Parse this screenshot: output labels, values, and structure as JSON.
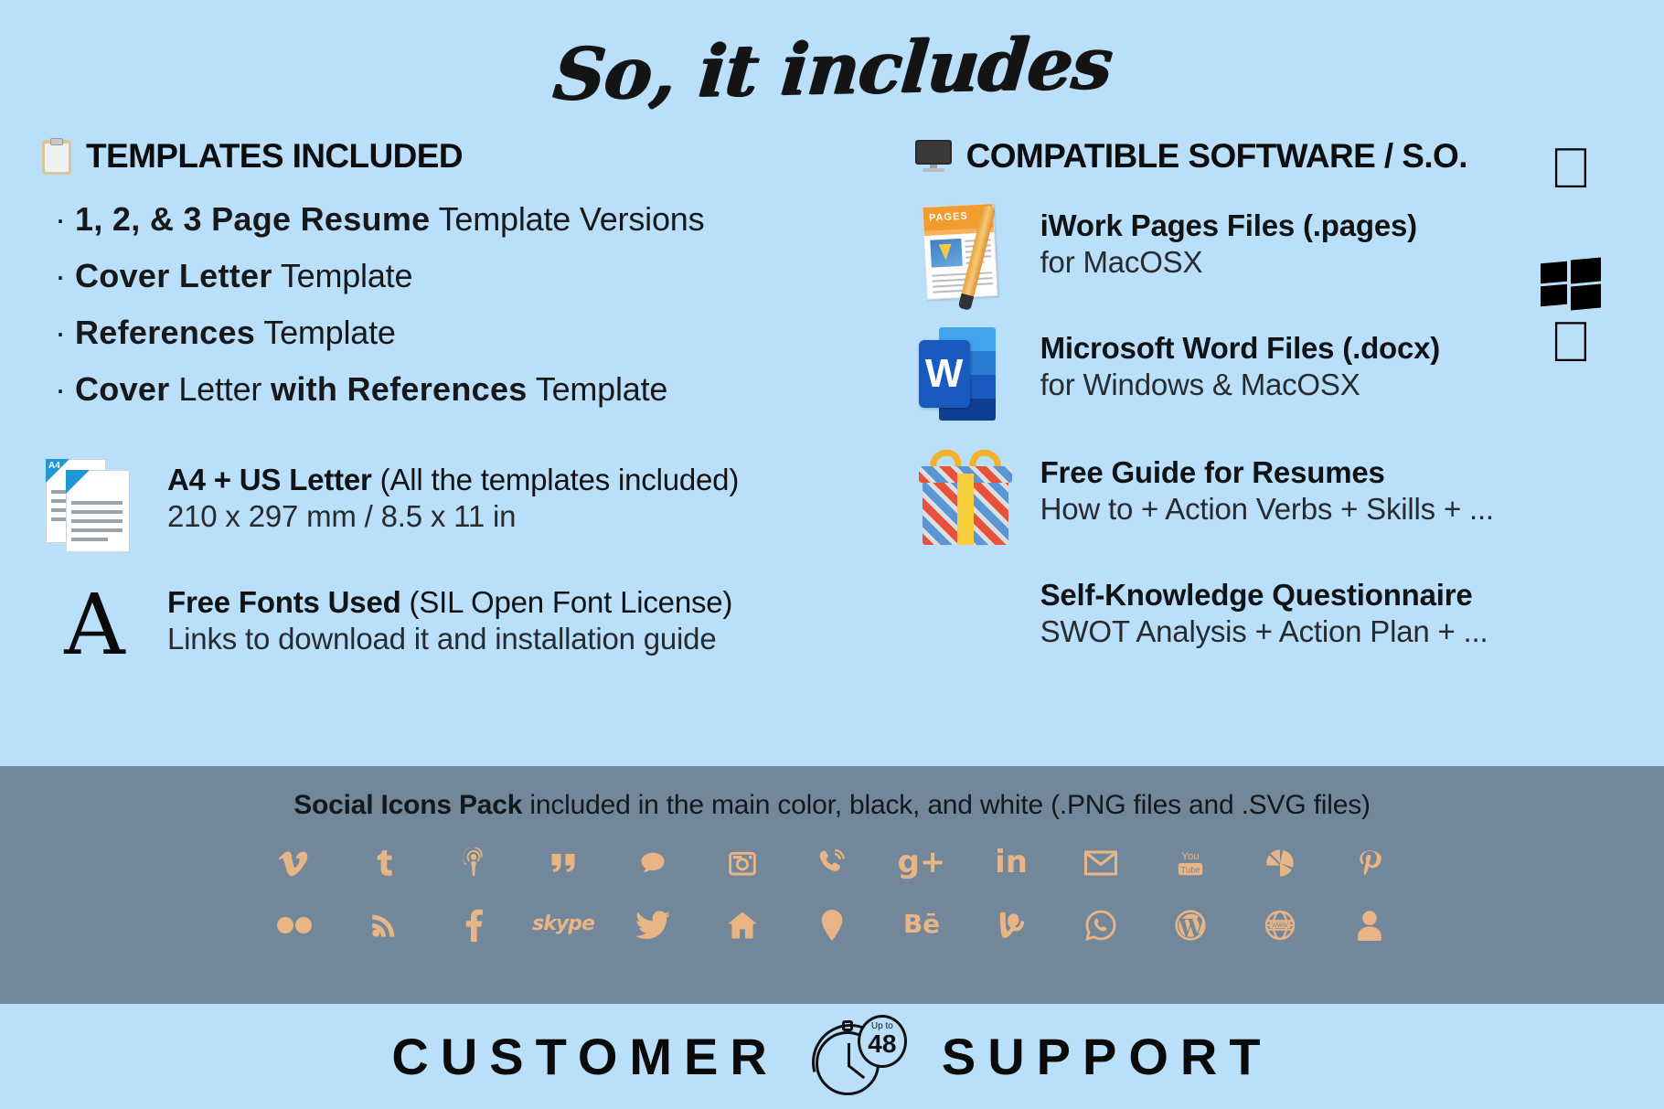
{
  "title": "So, it includes",
  "colors": {
    "background": "#b9dffb",
    "band": "#73879b",
    "social_icon": "#e9b585",
    "text": "#101214"
  },
  "left_column": {
    "heading": "TEMPLATES INCLUDED",
    "heading_icon": "clipboard-icon",
    "bullets": [
      {
        "bold": "1, 2, & 3 Page Resume",
        "rest": " Template Versions"
      },
      {
        "bold": "Cover Letter",
        "rest": " Template"
      },
      {
        "bold": "References",
        "rest": " Template"
      },
      {
        "bold": "Cover",
        "mid": " Letter ",
        "bold2": "with References",
        "rest": " Template"
      }
    ],
    "features": [
      {
        "icon": "a4-us-letter-documents-icon",
        "title_bold": "A4 + US Letter",
        "title_rest": " (All the templates included)",
        "subtitle": "210 x 297 mm / 8.5 x 11 in"
      },
      {
        "icon": "letter-a-font-icon",
        "icon_glyph": "A",
        "title_bold": "Free Fonts Used",
        "title_rest": " (SIL Open Font License)",
        "subtitle": "Links to download it and installation guide"
      }
    ]
  },
  "right_column": {
    "heading": "COMPATIBLE SOFTWARE / S.O.",
    "heading_icon": "monitor-icon",
    "features": [
      {
        "icon": "iwork-pages-icon",
        "icon_label": "PAGES",
        "title_bold": "iWork Pages Files (.pages)",
        "subtitle": "for MacOSX",
        "os_logos": [
          "apple-logo"
        ]
      },
      {
        "icon": "microsoft-word-icon",
        "icon_glyph": "W",
        "title_bold": "Microsoft Word Files (.docx)",
        "subtitle": "for Windows & MacOSX",
        "os_logos": [
          "windows-logo",
          "apple-logo"
        ]
      },
      {
        "icon": "gift-box-icon",
        "title_bold": "Free Guide for Resumes",
        "subtitle": "How to + Action Verbs + Skills + ..."
      },
      {
        "icon": "none",
        "title_bold": "Self-Knowledge Questionnaire",
        "subtitle": "SWOT Analysis + Action Plan + ..."
      }
    ]
  },
  "social_band": {
    "title_bold": "Social Icons Pack",
    "title_rest": " included in the main color, black, and white (.PNG files and .SVG files)",
    "row1": [
      "vimeo-icon",
      "tumblr-icon",
      "podcast-icon",
      "quote-icon",
      "chat-bubble-icon",
      "instagram-icon",
      "viber-icon",
      "google-plus-icon",
      "linkedin-icon",
      "email-icon",
      "youtube-icon",
      "picasa-icon",
      "pinterest-icon"
    ],
    "row2": [
      "flickr-icon",
      "rss-icon",
      "facebook-icon",
      "skype-icon",
      "twitter-icon",
      "home-icon",
      "map-pin-icon",
      "behance-icon",
      "vine-icon",
      "whatsapp-icon",
      "wordpress-icon",
      "globe-www-icon",
      "user-icon"
    ],
    "row1_glyphs": [
      "v",
      "t",
      "◉",
      "”",
      "💬",
      "▣",
      "✆",
      "g+",
      "in",
      "✉",
      "You",
      "◐",
      "P"
    ],
    "row2_glyphs": [
      "●●",
      "◔",
      "f",
      "skype",
      "✉",
      "⌂",
      "⚉",
      "Bē",
      "V",
      "◯",
      "W",
      "♁",
      "●"
    ]
  },
  "footer": {
    "left_word": "CUSTOMER",
    "right_word": "SUPPORT",
    "badge_up": "Up to",
    "badge_number": "48",
    "icon": "stopwatch-icon"
  }
}
